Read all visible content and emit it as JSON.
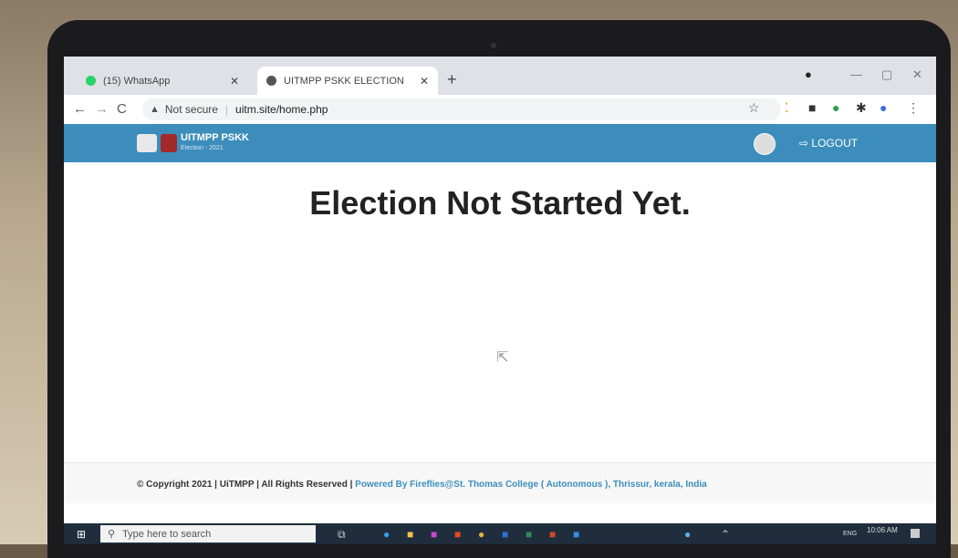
{
  "browser": {
    "tabs": [
      {
        "title": "(15) WhatsApp",
        "icon": "whatsapp-icon",
        "active": false
      },
      {
        "title": "UITMPP PSKK ELECTION",
        "icon": "globe-icon",
        "active": true
      }
    ],
    "new_tab": "+",
    "security_label": "Not secure",
    "url": "uitm.site/home.php"
  },
  "site": {
    "brand_title": "UITMPP PSKK",
    "brand_subtitle": "Election - 2021",
    "logout_label": "LOGOUT",
    "heading": "Election Not Started Yet.",
    "footer_copyright": "© Copyright 2021 | UiTMPP | All Rights Reserved |",
    "footer_powered": "Powered By Fireflies@St. Thomas College ( Autonomous ), Thrissur, kerala, India",
    "brand_color": "#3c8dbc"
  },
  "taskbar": {
    "search_placeholder": "Type here to search",
    "language": "ENG",
    "time": "10:06 AM"
  }
}
